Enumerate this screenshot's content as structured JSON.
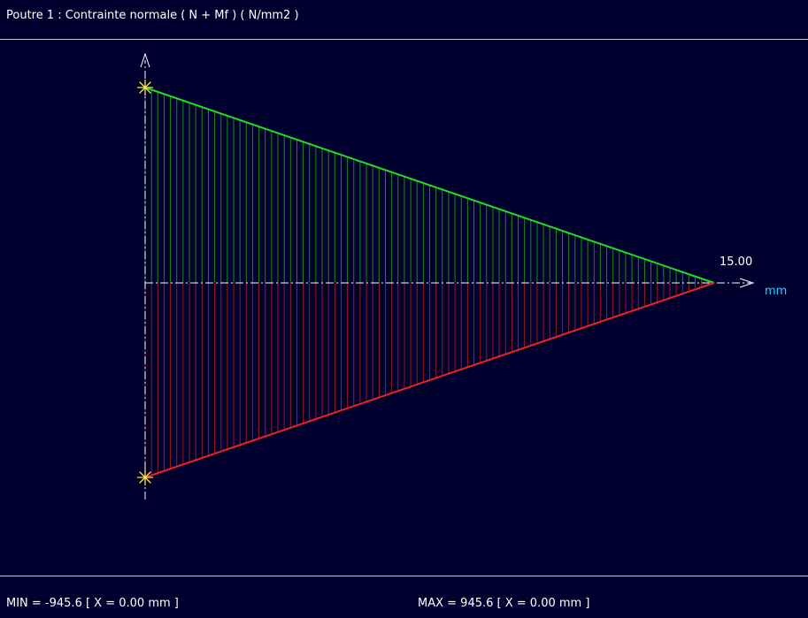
{
  "window": {
    "title": "Poutre 1 : Contrainte normale ( N + Mf ) ( N/mm2 )"
  },
  "status": {
    "min_text": "MIN = -945.6 [ X = 0.00 mm ]",
    "max_text": "MAX = 945.6 [ X = 0.00 mm ]"
  },
  "chart_data": {
    "type": "area",
    "x_unit_label": "mm",
    "x_end_label": "15.00",
    "xlim": [
      0,
      15
    ],
    "ylim": [
      -945.6,
      945.6
    ],
    "grid": false,
    "colors": {
      "positive": "#22dd22",
      "positive_fill": "#1a8a1a",
      "negative": "#ee2222",
      "negative_fill": "#9a1a1a",
      "axis": "#ffffff",
      "marker": "#ffe640",
      "unit_label": "#33ccff"
    },
    "series": [
      {
        "x": [
          0,
          15
        ],
        "values": [
          945.6,
          0
        ]
      },
      {
        "x": [
          0,
          15
        ],
        "values": [
          -945.6,
          0
        ]
      }
    ],
    "extrema": [
      {
        "x": 0,
        "value": 945.6
      },
      {
        "x": 0,
        "value": -945.6
      }
    ],
    "hatch_count": 90
  }
}
